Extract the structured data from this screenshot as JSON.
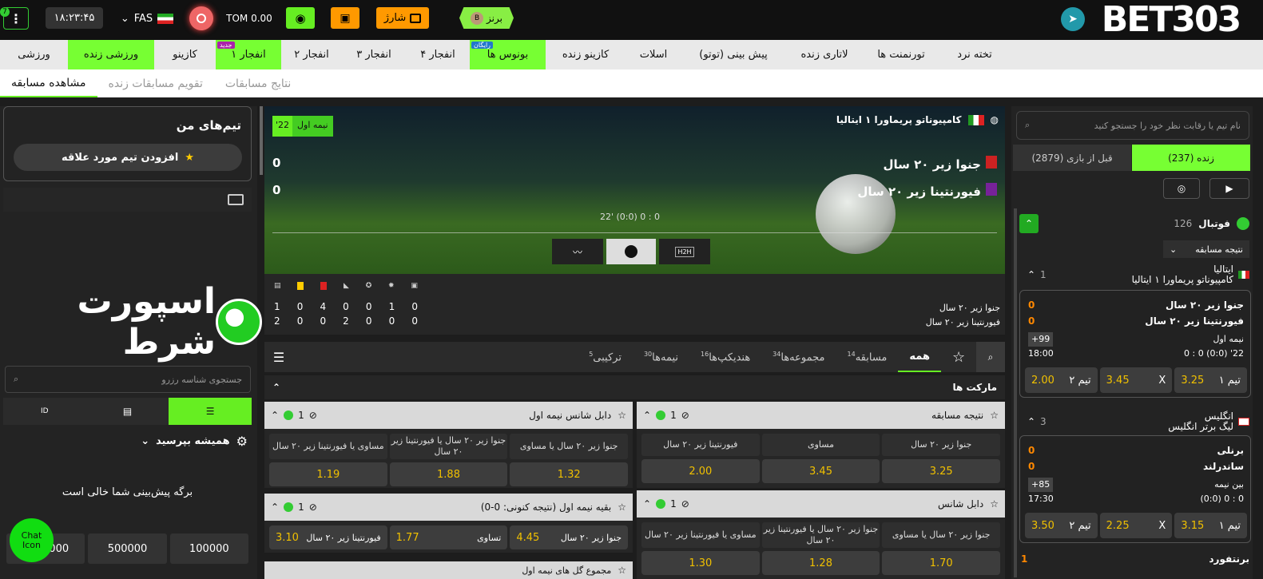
{
  "header": {
    "logo": "BET303",
    "clock": "۱۸:۲۳:۴۵",
    "lang": "FAS",
    "balance": "TOM 0.00",
    "charge": "شارژ",
    "rank": "برنز",
    "rank_badge": "B",
    "menu_badge": "7"
  },
  "nav": {
    "items": [
      "ورزشی",
      "ورزشی زنده",
      "کازینو",
      "انفجار ۱",
      "انفجار ۲",
      "انفجار ۳",
      "انفجار ۴",
      "بونوس ها",
      "کازینو زنده",
      "اسلات",
      "پیش بینی (توتو)",
      "لاتاری زنده",
      "تورنمنت ها",
      "تخته نرد"
    ],
    "new_badge": "جدید",
    "free_badge": "رایگان"
  },
  "subnav": {
    "items": [
      "مشاهده مسابقه",
      "تقویم مسابقات زنده",
      "نتایج مسابقات"
    ]
  },
  "left": {
    "search_placeholder": "نام تیم یا رقابت نظر خود را جستجو کنید",
    "tab_live": "زنده (237)",
    "tab_pre": "قبل از بازی (2879)",
    "sport": "فوتبال",
    "sport_count": "126",
    "market_select": "نتیجه مسابقه",
    "leagues": [
      {
        "country": "ایتالیا",
        "name": "کامپیوناتو پریماورا ۱ ایتالیا",
        "count": "1",
        "home": "جنوا زیر ۲۰ سال",
        "away": "فیورنتینا زیر ۲۰ سال",
        "hs": "0",
        "as": "0",
        "more": "99+",
        "period": "نیمه اول",
        "time": "18:00",
        "score": "22' (0:0) 0 : 0",
        "o1_lbl": "تیم ۱",
        "o1": "3.25",
        "ox_lbl": "X",
        "ox": "3.45",
        "o2_lbl": "تیم ۲",
        "o2": "2.00"
      },
      {
        "country": "انگلیس",
        "name": "لیگ برتر انگلیس",
        "count": "3",
        "home": "برنلی",
        "away": "ساندرلند",
        "hs": "0",
        "as": "0",
        "more": "85+",
        "period": "بین نیمه",
        "time": "17:30",
        "score": "0 : 0 (0:0)",
        "o1_lbl": "تیم ۱",
        "o1": "3.15",
        "ox_lbl": "X",
        "ox": "2.25",
        "o2_lbl": "تیم ۲",
        "o2": "3.50"
      }
    ],
    "next_team": "برنتفورد",
    "next_score": "1"
  },
  "match": {
    "league": "کامپیوناتو پریماورا ۱ ایتالیا",
    "period": "نیمه اول",
    "minute": "'22",
    "home": "جنوا زیر ۲۰ سال",
    "away": "فیورنتینا زیر ۲۰ سال",
    "home_score": "0",
    "away_score": "0",
    "time_score": "22' (0:0) 0 : 0",
    "h2h": "H2H",
    "stats_home": [
      "0",
      "1",
      "0",
      "0",
      "4",
      "0",
      "1"
    ],
    "stats_away": [
      "0",
      "0",
      "0",
      "2",
      "0",
      "0",
      "2"
    ]
  },
  "markets": {
    "tabs": [
      {
        "label": "همه",
        "count": ""
      },
      {
        "label": "مسابقه",
        "count": "14"
      },
      {
        "label": "مجموعه‌ها",
        "count": "34"
      },
      {
        "label": "هندیکپ‌ها",
        "count": "16"
      },
      {
        "label": "نیمه‌ها",
        "count": "30"
      },
      {
        "label": "ترکیبی",
        "count": "5"
      }
    ],
    "title": "مارکت ها",
    "m1": {
      "title": "نتیجه مسابقه",
      "count": "1",
      "labels": [
        "جنوا زیر ۲۰ سال",
        "مساوی",
        "فیورنتینا زیر ۲۰ سال"
      ],
      "odds": [
        "3.25",
        "3.45",
        "2.00"
      ]
    },
    "m2": {
      "title": "دابل شانس",
      "count": "1",
      "labels": [
        "جنوا زیر ۲۰ سال یا مساوی",
        "جنوا زیر ۲۰ سال یا فیورنتینا زیر ۲۰ سال",
        "مساوی یا فیورنتینا زیر ۲۰ سال"
      ],
      "odds": [
        "1.70",
        "1.28",
        "1.30"
      ]
    },
    "m3": {
      "title": "دابل شانس نیمه اول",
      "count": "1",
      "labels": [
        "جنوا زیر ۲۰ سال یا مساوی",
        "جنوا زیر ۲۰ سال یا فیورنتینا زیر ۲۰ سال",
        "مساوی یا فیورنتینا زیر ۲۰ سال"
      ],
      "odds": [
        "1.32",
        "1.88",
        "1.19"
      ]
    },
    "m4": {
      "title": "بقیه نیمه اول (نتیجه کنونی: 0-0)",
      "count": "1",
      "labels": [
        "جنوا زیر ۲۰ سال",
        "تساوی",
        "فیورنتینا زیر ۲۰ سال"
      ],
      "odds": [
        "4.45",
        "1.77",
        "3.10"
      ]
    },
    "m5": {
      "title": "مجموع گل های نیمه اول"
    }
  },
  "right": {
    "my_teams": "تیم‌های من",
    "add_team": "افزودن تیم مورد علاقه",
    "brand": "اسپورت شرط",
    "search_placeholder": "جستجوی شناسه رزرو",
    "faq": "همیشه بپرسید",
    "empty": "برگه پیش‌بینی شما خالی است",
    "amounts": [
      "100000",
      "500000",
      "1000000"
    ],
    "chat": "Chat Icon"
  }
}
